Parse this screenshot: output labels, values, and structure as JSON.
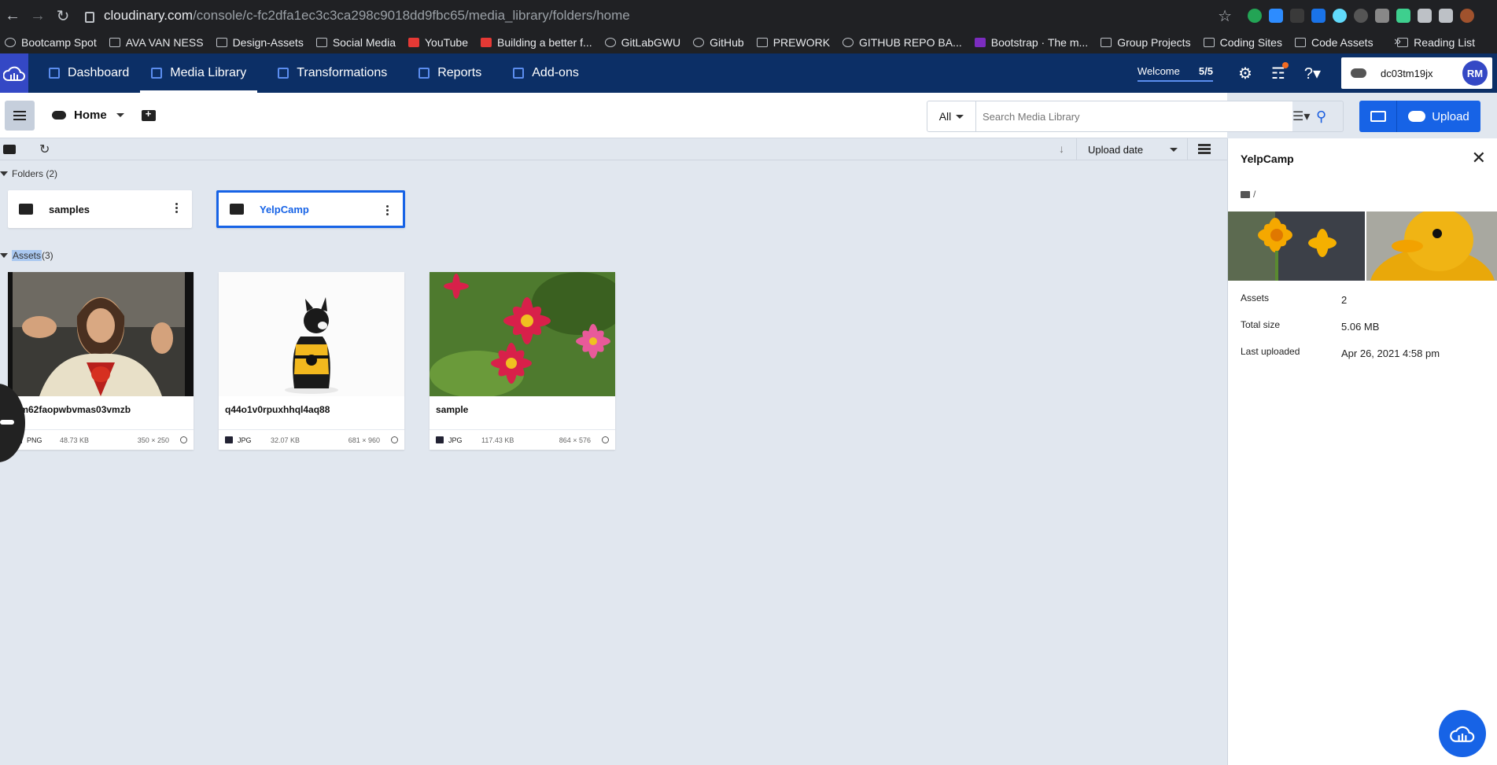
{
  "browser": {
    "url_host": "cloudinary.com",
    "url_path": "/console/c-fc2dfa1ec3c3ca298c9018dd9fbc65/media_library/folders/home",
    "bookmarks": [
      {
        "label": "Bootcamp Spot"
      },
      {
        "label": "AVA VAN NESS"
      },
      {
        "label": "Design-Assets"
      },
      {
        "label": "Social Media"
      },
      {
        "label": "YouTube"
      },
      {
        "label": "Building a better f..."
      },
      {
        "label": "GitLabGWU"
      },
      {
        "label": "GitHub"
      },
      {
        "label": "PREWORK"
      },
      {
        "label": "GITHUB REPO BA..."
      },
      {
        "label": "Bootstrap · The m..."
      },
      {
        "label": "Group Projects"
      },
      {
        "label": "Coding Sites"
      },
      {
        "label": "Code Assets"
      }
    ],
    "reading_list": "Reading List"
  },
  "appnav": {
    "items": [
      {
        "label": "Dashboard"
      },
      {
        "label": "Media Library"
      },
      {
        "label": "Transformations"
      },
      {
        "label": "Reports"
      },
      {
        "label": "Add-ons"
      }
    ],
    "welcome": "Welcome",
    "welcome_progress": "5/5",
    "account_name": "dc03tm19jx",
    "avatar_initials": "RM"
  },
  "toolbar": {
    "home_label": "Home",
    "filter_all": "All",
    "search_placeholder": "Search Media Library",
    "upload_label": "Upload"
  },
  "subbar": {
    "sort_label": "Upload date"
  },
  "folders": {
    "header": "Folders (2)",
    "items": [
      {
        "name": "samples"
      },
      {
        "name": "YelpCamp"
      }
    ]
  },
  "assets": {
    "header_word": "Assets",
    "header_count": " (3)",
    "items": [
      {
        "name": "gm62faopwbvmas03vmzb",
        "format": "PNG",
        "size": "48.73 KB",
        "dimensions": "350 × 250"
      },
      {
        "name": "q44o1v0rpuxhhql4aq88",
        "format": "JPG",
        "size": "32.07 KB",
        "dimensions": "681 × 960"
      },
      {
        "name": "sample",
        "format": "JPG",
        "size": "117.43 KB",
        "dimensions": "864 × 576"
      }
    ]
  },
  "panel": {
    "title": "YelpCamp",
    "path": "/",
    "rows": [
      {
        "key": "Assets",
        "value": "2"
      },
      {
        "key": "Total size",
        "value": "5.06 MB"
      },
      {
        "key": "Last uploaded",
        "value": "Apr 26, 2021 4:58 pm"
      }
    ]
  },
  "colors": {
    "nav_bg": "#0c2f66",
    "accent": "#1763e6",
    "content_bg": "#e1e7ef"
  }
}
